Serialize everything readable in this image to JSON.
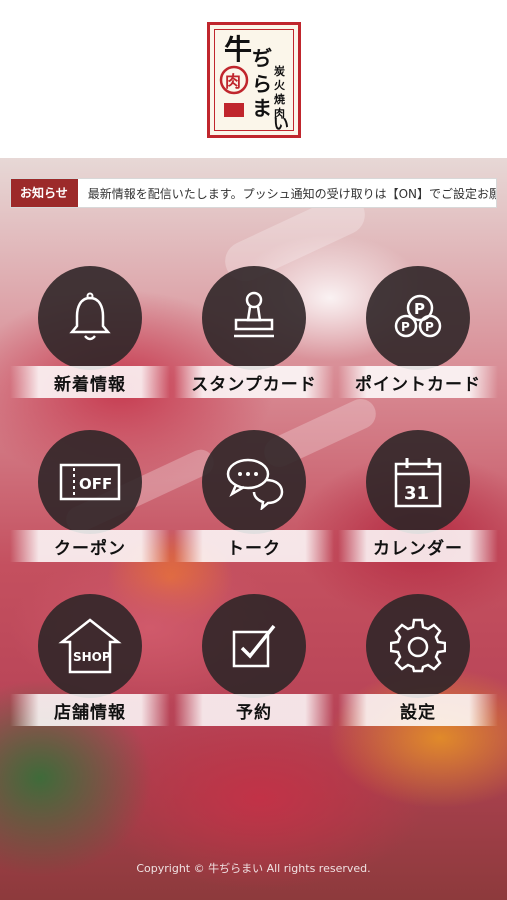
{
  "header": {
    "logo_text": "牛ぢらまい 炭火焼肉 肉"
  },
  "ticker": {
    "badge": "お知らせ",
    "message": "最新情報を配信いたします。プッシュ通知の受け取りは【ON】でご設定お願いします。"
  },
  "menu": {
    "items": [
      {
        "label": "新着情報",
        "icon": "bell-icon"
      },
      {
        "label": "スタンプカード",
        "icon": "stamp-icon"
      },
      {
        "label": "ポイントカード",
        "icon": "points-icon"
      },
      {
        "label": "クーポン",
        "icon": "coupon-icon",
        "icon_text": "OFF"
      },
      {
        "label": "トーク",
        "icon": "chat-icon"
      },
      {
        "label": "カレンダー",
        "icon": "calendar-icon",
        "icon_text": "31"
      },
      {
        "label": "店舗情報",
        "icon": "shop-icon",
        "icon_text": "SHOP"
      },
      {
        "label": "予約",
        "icon": "reservation-icon"
      },
      {
        "label": "設定",
        "icon": "gear-icon"
      }
    ]
  },
  "footer": {
    "copyright": "Copyright © 牛ぢらまい All rights reserved."
  },
  "colors": {
    "accent": "#c0262d",
    "badge": "#9c2a2a",
    "tile": "#302628"
  }
}
